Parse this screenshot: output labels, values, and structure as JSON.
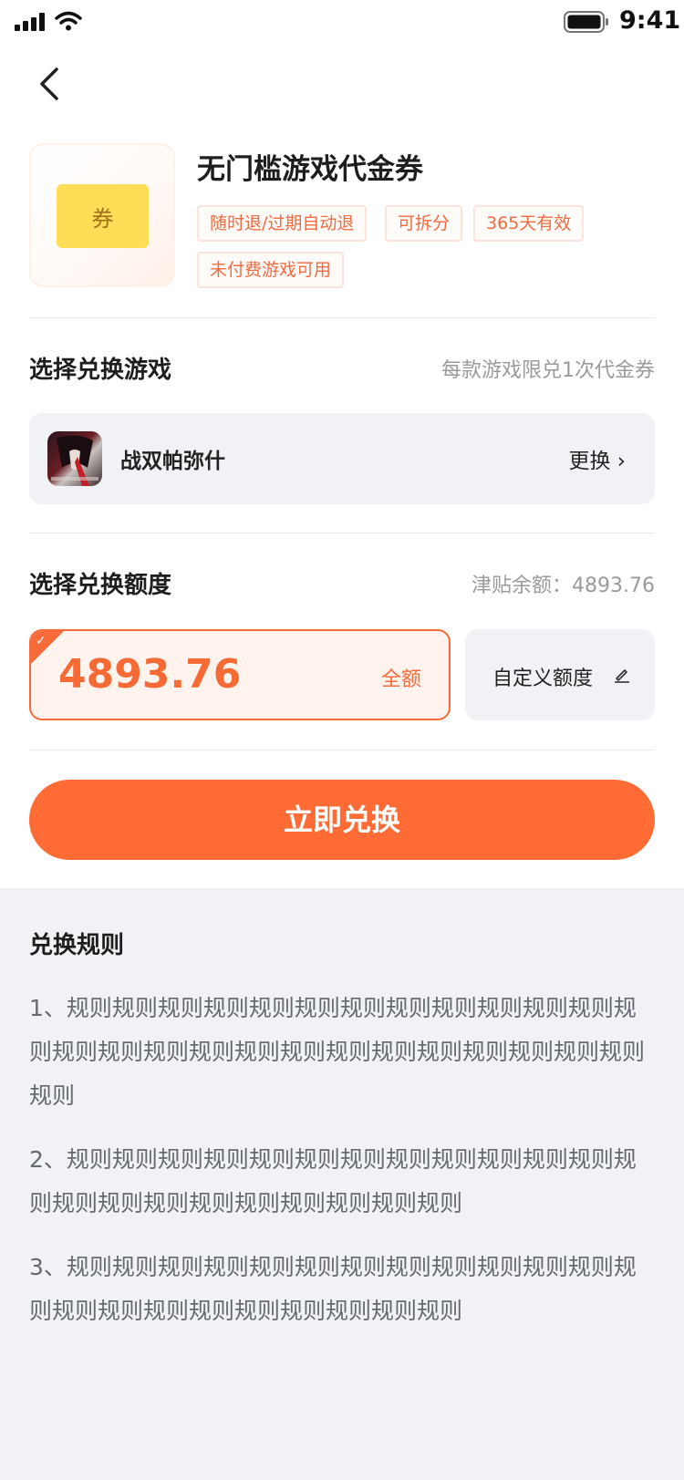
{
  "status_bar": {
    "time": "9:41"
  },
  "product": {
    "coupon_label": "券",
    "title": "无门槛游戏代金券",
    "tags": [
      "随时退/过期自动退",
      "可拆分",
      "365天有效",
      "未付费游戏可用"
    ]
  },
  "game_section": {
    "title": "选择兑换游戏",
    "note": "每款游戏限兑1次代金券",
    "game_name": "战双帕弥什",
    "change_label": "更换 ›"
  },
  "amount_section": {
    "title": "选择兑换额度",
    "balance_text": "津贴余额：4893.76",
    "selected_amount": "4893.76",
    "all_label": "全额",
    "custom_label": "自定义额度"
  },
  "redeem_button": "立即兑换",
  "rules": {
    "title": "兑换规则",
    "items": [
      "1、规则规则规则规则规则规则规则规则规则规则规则规则规则规则规则规则规则规则规则规则规则规则规则规则规则规则规则",
      "2、规则规则规则规则规则规则规则规则规则规则规则规则规则规则规则规则规则规则规则规则规则规则",
      "3、规则规则规则规则规则规则规则规则规则规则规则规则规则规则规则规则规则规则规则规则规则规则"
    ]
  }
}
